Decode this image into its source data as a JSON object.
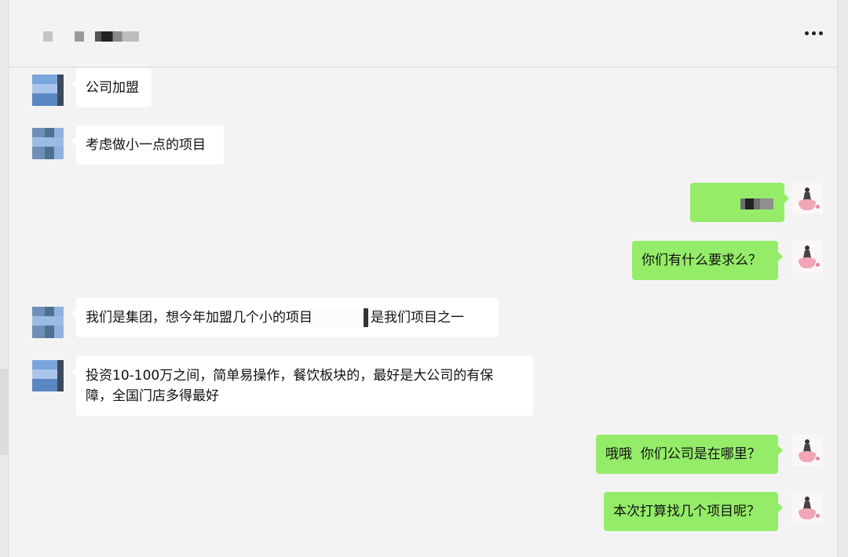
{
  "header": {
    "more_icon": "more-dots-icon"
  },
  "messages": [
    {
      "side": "left",
      "text": "公司加盟"
    },
    {
      "side": "left",
      "text": "考虑做小一点的项目"
    },
    {
      "side": "right",
      "text": ""
    },
    {
      "side": "right",
      "text": "你们有什么要求么？"
    },
    {
      "side": "left",
      "text_before": "我们是集团，想今年加盟几个小的项目",
      "text_after": "是我们项目之一"
    },
    {
      "side": "left",
      "line1": "投资10-100万之间，简单易操作，餐饮板块的，最好是大公司的有保",
      "line2": "障，全国门店多得最好"
    },
    {
      "side": "right",
      "text": "哦哦  你们公司是在哪里？"
    },
    {
      "side": "right",
      "text": "本次打算找几个项目呢？"
    }
  ],
  "colors": {
    "sent_bubble": "#95ec69",
    "received_bubble": "#ffffff",
    "background": "#f3f3f3"
  }
}
